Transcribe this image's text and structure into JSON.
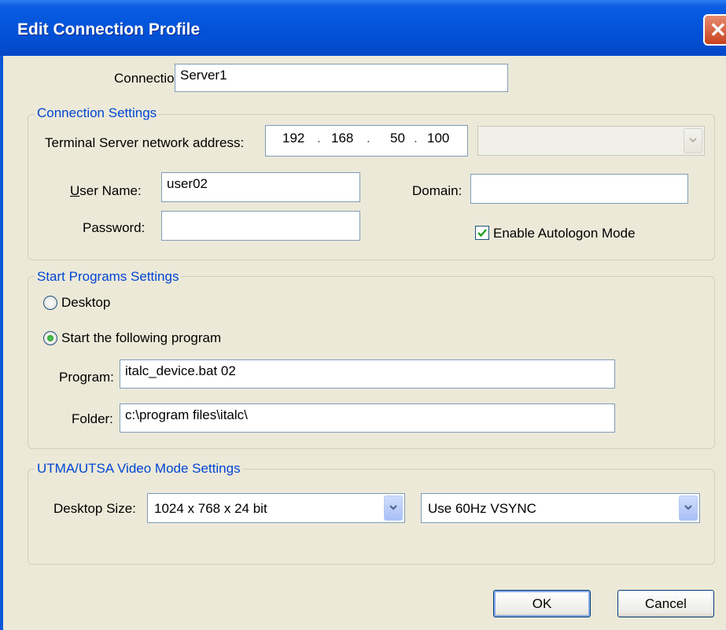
{
  "window": {
    "title": "Edit Connection Profile",
    "close_symbol": "✕"
  },
  "connection": {
    "label": "Connection:",
    "value": "Server1"
  },
  "connection_settings": {
    "legend": "Connection Settings",
    "address_label": "Terminal Server network address:",
    "ip": [
      "192",
      "168",
      "50",
      "100"
    ],
    "ip_separator": ".",
    "address_dropdown_value": "",
    "username_label_underlined": "U",
    "username_label_rest": "ser Name:",
    "username_value": "user02",
    "domain_label": "Domain:",
    "domain_value": "",
    "password_label": "Password:",
    "password_value": "",
    "autologon_label": "Enable Autologon Mode",
    "autologon_checked": true
  },
  "start_programs": {
    "legend": "Start Programs  Settings",
    "desktop_label": "Desktop",
    "start_program_label": "Start the following program",
    "selected": "start_program",
    "program_label": "Program:",
    "program_value": "italc_device.bat 02",
    "folder_label": "Folder:",
    "folder_value": "c:\\program files\\italc\\"
  },
  "video_mode": {
    "legend": "UTMA/UTSA  Video Mode Settings",
    "desktop_size_label": "Desktop Size:",
    "desktop_size_value": "1024 x 768 x 24 bit",
    "vsync_value": "Use 60Hz VSYNC"
  },
  "buttons": {
    "ok": "OK",
    "cancel": "Cancel"
  },
  "colors": {
    "title_bar": "#0253d8",
    "group_legend": "#0046d5",
    "dialog_bg": "#ece9d8"
  }
}
